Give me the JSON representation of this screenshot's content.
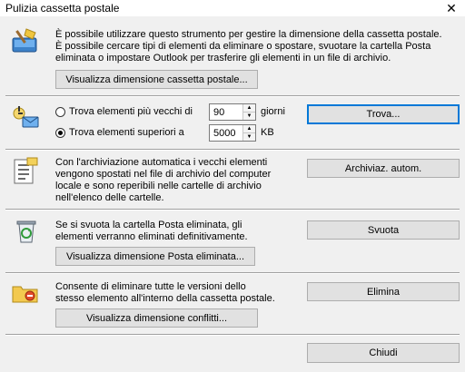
{
  "window": {
    "title": "Pulizia cassetta postale",
    "close_glyph": "✕"
  },
  "section1": {
    "text_lines": [
      "È possibile utilizzare questo strumento per gestire la dimensione della cassetta postale.",
      "È possibile cercare tipi di elementi da eliminare o spostare, svuotare la cartella Posta",
      "eliminata o impostare Outlook per trasferire gli elementi in un file di archivio."
    ],
    "view_size_label": "Visualizza dimensione cassetta postale...",
    "icon": "mailbox-broom-icon"
  },
  "section2": {
    "older_label": "Trova elementi più vecchi di",
    "older_value": "90",
    "older_unit": "giorni",
    "larger_label": "Trova elementi superiori a",
    "larger_value": "5000",
    "larger_unit": "KB",
    "selected": "larger",
    "find_label": "Trova...",
    "icon": "find-items-icon"
  },
  "section3": {
    "text_lines": [
      "Con l'archiviazione automatica i vecchi elementi",
      "vengono spostati nel file di archivio del computer",
      "locale e sono reperibili nelle cartelle di archivio",
      "nell'elenco delle cartelle."
    ],
    "autoarchive_label": "Archiviaz. autom.",
    "icon": "autoarchive-icon"
  },
  "section4": {
    "text_lines": [
      "Se si svuota la cartella Posta eliminata, gli",
      "elementi verranno eliminati definitivamente."
    ],
    "empty_label": "Svuota",
    "view_deleted_label": "Visualizza dimensione Posta eliminata...",
    "icon": "recycle-bin-icon"
  },
  "section5": {
    "text_lines": [
      "Consente di eliminare tutte le versioni dello",
      "stesso elemento all'interno della cassetta postale."
    ],
    "delete_label": "Elimina",
    "view_conflicts_label": "Visualizza dimensione conflitti...",
    "icon": "conflicts-folder-icon"
  },
  "footer": {
    "close_label": "Chiudi"
  }
}
